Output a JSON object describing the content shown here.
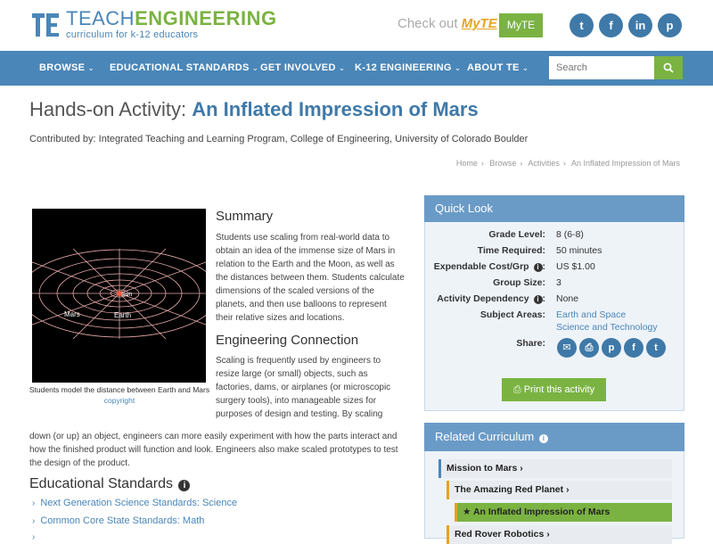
{
  "brand": {
    "title_light": "TEACH",
    "title_bold": "ENGINEERING",
    "tagline": "curriculum for k-12 educators"
  },
  "topbar": {
    "checkout_prefix": "Check out ",
    "checkout_link": "MyTE",
    "myte_button": "MyTE",
    "social": [
      {
        "icon": "twitter-icon",
        "glyph": "t"
      },
      {
        "icon": "facebook-icon",
        "glyph": "f"
      },
      {
        "icon": "linkedin-icon",
        "glyph": "in"
      },
      {
        "icon": "pinterest-icon",
        "glyph": "p"
      }
    ]
  },
  "nav": {
    "items": [
      "BROWSE",
      "EDUCATIONAL STANDARDS",
      "GET INVOLVED",
      "K-12 ENGINEERING",
      "ABOUT TE"
    ],
    "search_placeholder": "Search"
  },
  "page": {
    "title_prefix": "Hands-on Activity: ",
    "title_name": "An Inflated Impression of Mars",
    "contributed": "Contributed by: Integrated Teaching and Learning Program, College of Engineering, University of Colorado Boulder",
    "breadcrumb": [
      "Home",
      "Browse",
      "Activities",
      "An Inflated Impression of Mars"
    ]
  },
  "figure": {
    "caption": "Students model the distance between Earth and Mars",
    "copyright": "copyright",
    "labels": {
      "mars": "Mars",
      "earth": "Earth",
      "sun": "Sun"
    }
  },
  "summary": {
    "heading": "Summary",
    "text": "Students use scaling from real-world data to obtain an idea of the immense size of Mars in relation to the Earth and the Moon, as well as the distances between them. Students calculate dimensions of the scaled versions of the planets, and then use balloons to represent their relative sizes and locations."
  },
  "engineering": {
    "heading": "Engineering Connection",
    "text_narrow": "Scaling is frequently used by engineers to resize large (or small) objects, such as factories, dams, or airplanes (or microscopic surgery tools), into manageable sizes for purposes of design and testing. By scaling",
    "text_wide": "down (or up) an object, engineers can more easily experiment with how the parts interact and how the finished product will function and look. Engineers also make scaled prototypes to test the design of the product."
  },
  "standards": {
    "heading": "Educational Standards",
    "items": [
      "Next Generation Science Standards: Science",
      "Common Core State Standards: Math"
    ]
  },
  "quick_look": {
    "heading": "Quick Look",
    "rows": [
      {
        "label": "Grade Level:",
        "value": "8 (6-8)"
      },
      {
        "label": "Time Required:",
        "value": "50 minutes"
      },
      {
        "label": "Expendable Cost/Grp",
        "value": "US $1.00"
      },
      {
        "label": "Group Size:",
        "value": "3"
      },
      {
        "label": "Activity Dependency",
        "value": "None"
      },
      {
        "label": "Subject Areas:",
        "value": "Earth and Space",
        "value2": "Science and Technology"
      },
      {
        "label": "Share:"
      }
    ],
    "share_icons": [
      "email-icon",
      "print-icon",
      "pinterest-icon",
      "facebook-icon",
      "twitter-icon"
    ],
    "print_button": "Print this activity"
  },
  "related": {
    "heading": "Related Curriculum",
    "items": [
      "Mission to Mars",
      "The Amazing Red Planet",
      "An Inflated Impression of Mars",
      "Red Rover Robotics"
    ]
  }
}
